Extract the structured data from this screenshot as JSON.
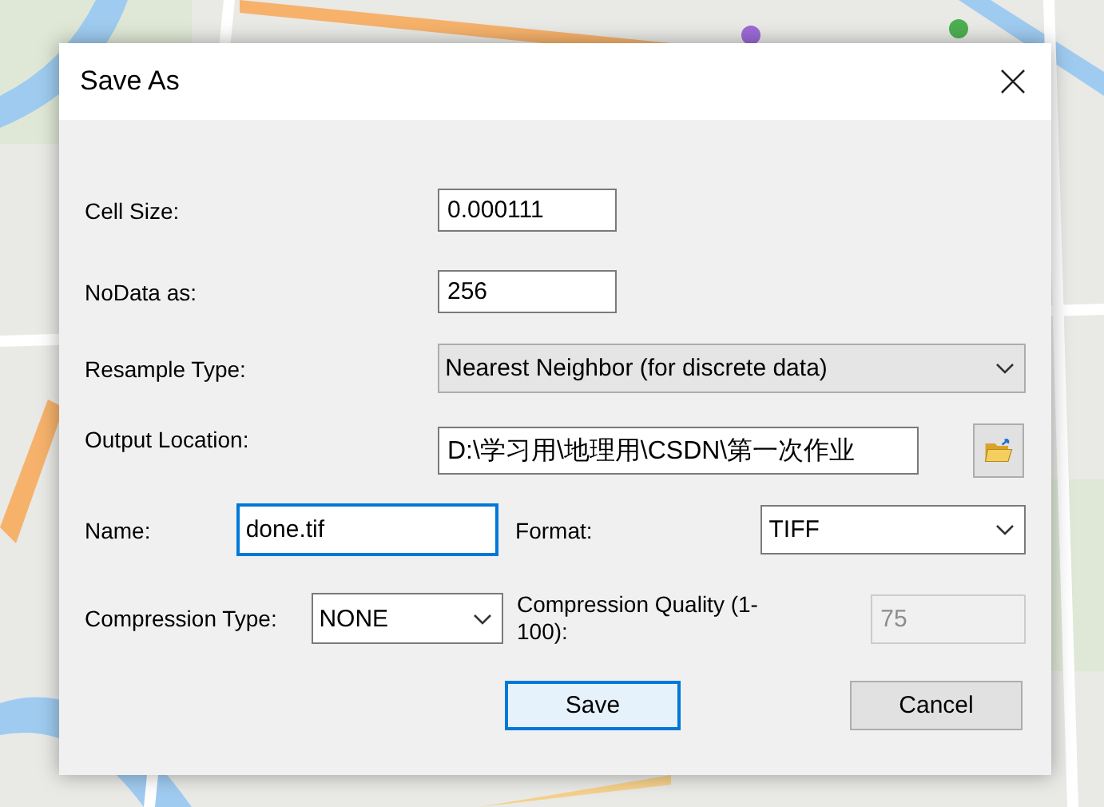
{
  "dialog": {
    "title": "Save As"
  },
  "fields": [
    {
      "label": "Cell Size:",
      "value": "0.000111"
    },
    {
      "label": "NoData as:",
      "value": "256"
    }
  ],
  "resample": {
    "label": "Resample Type:",
    "value": "Nearest Neighbor (for discrete data)"
  },
  "output": {
    "label": "Output Location:",
    "value": "D:\\学习用\\地理用\\CSDN\\第一次作业"
  },
  "name": {
    "label": "Name:",
    "value": "done.tif",
    "focused": true
  },
  "format": {
    "label": "Format:",
    "value": "TIFF"
  },
  "compression_type": {
    "label": "Compression Type:",
    "value": "NONE"
  },
  "compression_quality": {
    "label": "Compression Quality (1-100):",
    "value": "75",
    "disabled": true
  },
  "buttons": [
    {
      "label": "Save",
      "default": true
    },
    {
      "label": "Cancel",
      "default": false
    }
  ]
}
